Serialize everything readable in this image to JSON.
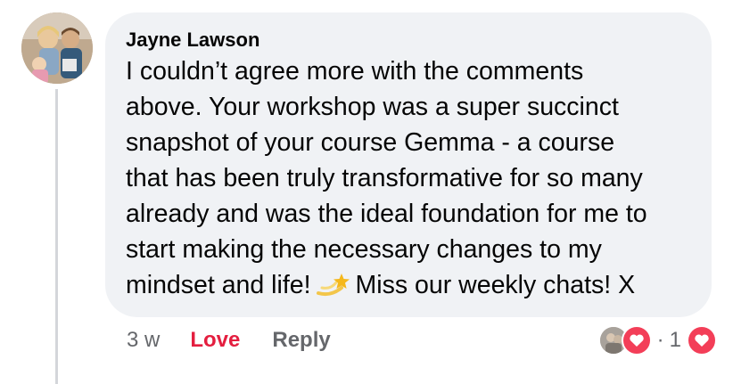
{
  "comment": {
    "author": "Jayne Lawson",
    "text_lines": [
      "I couldn’t agree more with the comments",
      "above. Your workshop was a super succinct",
      "snapshot of your course Gemma - a course",
      "that has been truly transformative for so many",
      "already and was the ideal foundation for me to",
      "start making the necessary changes to my"
    ],
    "last_line_before_emoji": "mindset and life!",
    "emoji": "dizzy-emoji",
    "last_line_after_emoji": "Miss our weekly chats! X"
  },
  "actions": {
    "timestamp": "3 w",
    "love_label": "Love",
    "reply_label": "Reply"
  },
  "reactions": {
    "separator": "·",
    "count": "1",
    "reaction_icon": "heart-icon",
    "colors": {
      "love": "#e41e3f",
      "heart_badge": "#f33e58",
      "bubble": "#f0f2f5",
      "meta_text": "#65676b"
    }
  }
}
